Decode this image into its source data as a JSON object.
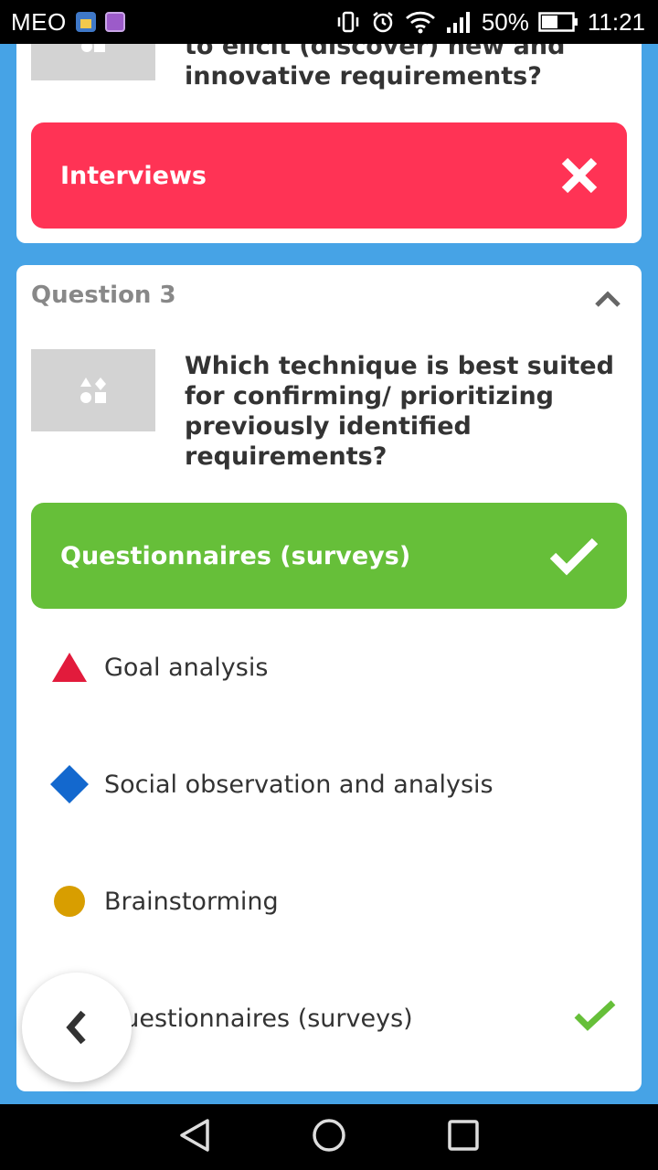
{
  "status_bar": {
    "carrier": "MEO",
    "battery": "50%",
    "time": "11:21",
    "icons": [
      "vibrate-icon",
      "alarm-icon",
      "wifi-icon",
      "signal-icon",
      "battery-icon"
    ]
  },
  "prev_question": {
    "text_partial": "to elicit (discover) new and innovative requirements?",
    "answer_label": "Interviews",
    "answer_status": "wrong",
    "answer_color": "#FF3355"
  },
  "question": {
    "header": "Question 3",
    "text": "Which technique is best suited for confirming/ prioritizing previously identified requirements?",
    "answer_label": "Questionnaires (surveys)",
    "answer_status": "correct",
    "answer_color": "#66BF39",
    "options": [
      {
        "label": "Goal analysis",
        "shape": "triangle",
        "color": "#E21B3C"
      },
      {
        "label": "Social observation and analysis",
        "shape": "diamond",
        "color": "#1368CE"
      },
      {
        "label": "Brainstorming",
        "shape": "circle",
        "color": "#D89E00"
      },
      {
        "label": "Questionnaires (surveys)",
        "shape": "square",
        "color": "#26890C",
        "correct": true
      }
    ]
  }
}
